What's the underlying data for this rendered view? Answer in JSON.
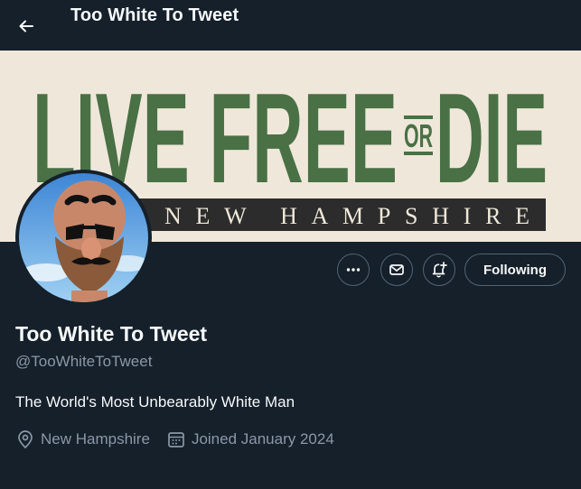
{
  "header": {
    "title": "Too White To Tweet",
    "back_icon": "arrow-left-icon"
  },
  "banner": {
    "main_text_left": "LIVE FREE",
    "or_text": "OR",
    "main_text_right": "DIE",
    "sub_text": "NEW HAMPSHIRE",
    "colors": {
      "background": "#efe8da",
      "text_green": "#4a7045",
      "strip": "#2c2c2c"
    }
  },
  "actions": {
    "more_icon": "more-dots-icon",
    "message_icon": "envelope-icon",
    "notify_icon": "bell-plus-icon",
    "follow_label": "Following"
  },
  "profile": {
    "display_name": "Too White To Tweet",
    "handle": "@TooWhiteToTweet",
    "bio": "The World's Most Unbearably White Man",
    "location": "New Hampshire",
    "joined": "Joined January 2024"
  },
  "theme": {
    "background": "#15202b",
    "text": "#f7f9f9",
    "muted": "#8b98a5",
    "border": "#536471"
  }
}
